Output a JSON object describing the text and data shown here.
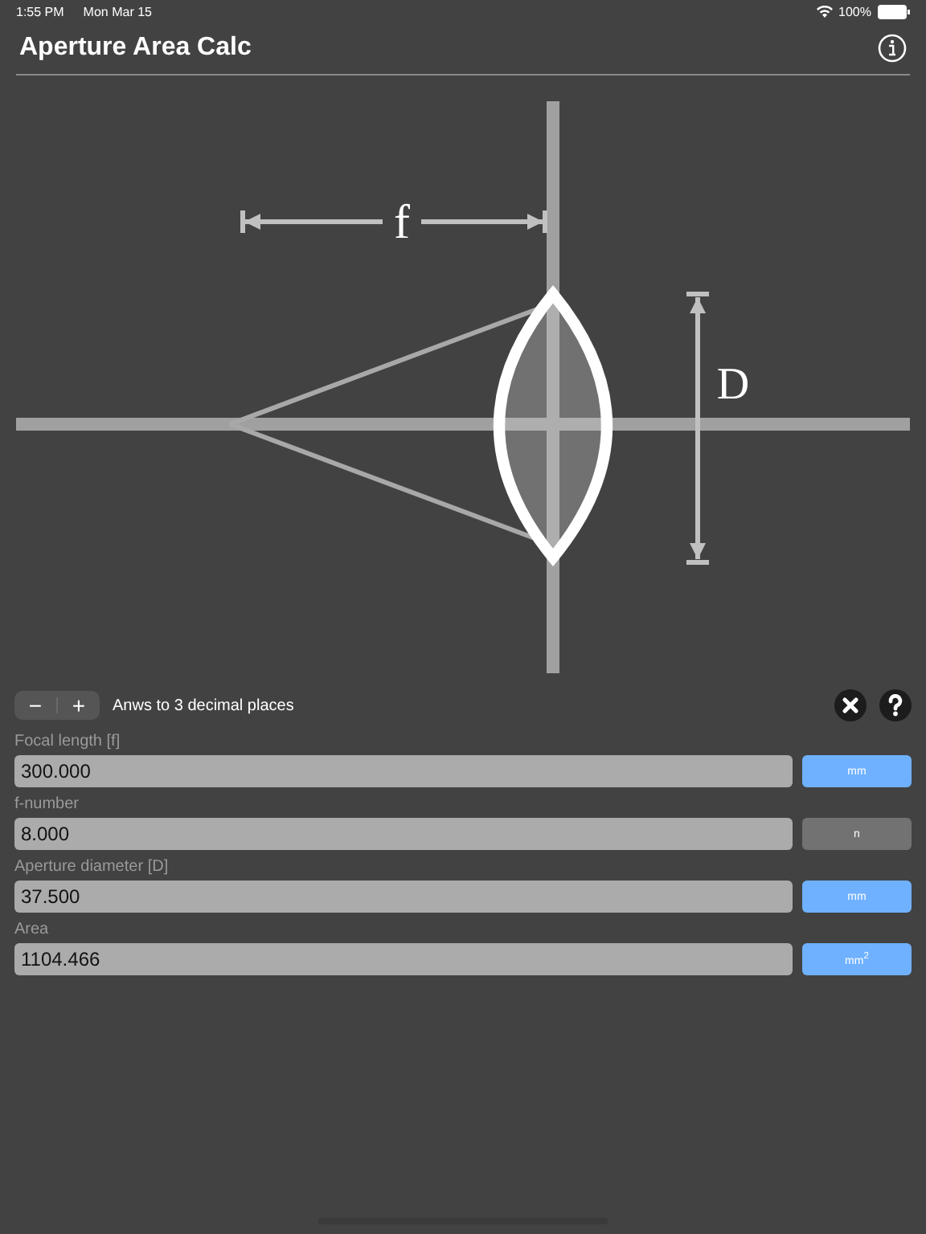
{
  "status_bar": {
    "time": "1:55 PM",
    "date": "Mon Mar 15",
    "battery": "100%"
  },
  "nav": {
    "title": "Aperture Area Calc"
  },
  "diagram": {
    "focal_label": "f",
    "diameter_label": "D"
  },
  "precision": {
    "decrement": "−",
    "increment": "+",
    "label": "Anws to 3 decimal places"
  },
  "fields": [
    {
      "label": "Focal length [f]",
      "value": "300.000",
      "unit": "mm",
      "selected": true
    },
    {
      "label": "f-number",
      "value": "8.000",
      "unit": "n",
      "selected": false
    },
    {
      "label": "Aperture diameter [D]",
      "value": "37.500",
      "unit": "mm",
      "selected": true
    },
    {
      "label": "Area",
      "value": "1104.466",
      "unit": "mm$^{2}$",
      "selected": true
    }
  ]
}
